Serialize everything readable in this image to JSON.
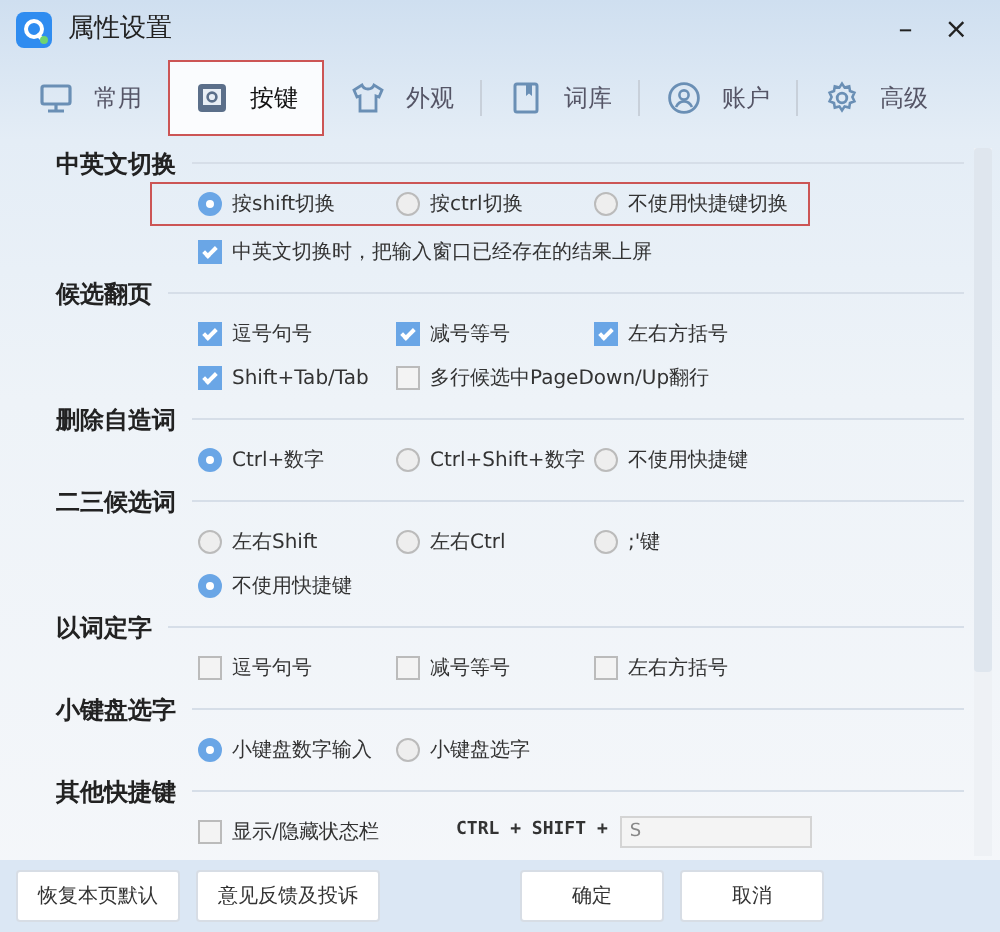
{
  "window": {
    "title": "属性设置",
    "minimize": "–",
    "close": "×"
  },
  "tabs": [
    {
      "label": "常用",
      "selected": false
    },
    {
      "label": "按键",
      "selected": true
    },
    {
      "label": "外观",
      "selected": false
    },
    {
      "label": "词库",
      "selected": false
    },
    {
      "label": "账户",
      "selected": false
    },
    {
      "label": "高级",
      "selected": false
    }
  ],
  "sections": [
    {
      "title": "中英文切换",
      "rows": [
        {
          "highlighted": true,
          "options": [
            {
              "kind": "radio",
              "label": "按shift切换",
              "selected": true
            },
            {
              "kind": "radio",
              "label": "按ctrl切换",
              "selected": false
            },
            {
              "kind": "radio",
              "label": "不使用快捷键切换",
              "selected": false
            }
          ]
        },
        {
          "highlighted": false,
          "options": [
            {
              "kind": "checkbox",
              "label": "中英文切换时，把输入窗口已经存在的结果上屏",
              "checked": true
            }
          ]
        }
      ]
    },
    {
      "title": "候选翻页",
      "rows": [
        {
          "highlighted": false,
          "options": [
            {
              "kind": "checkbox",
              "label": "逗号句号",
              "checked": true
            },
            {
              "kind": "checkbox",
              "label": "减号等号",
              "checked": true
            },
            {
              "kind": "checkbox",
              "label": "左右方括号",
              "checked": true
            }
          ]
        },
        {
          "highlighted": false,
          "options": [
            {
              "kind": "checkbox",
              "label": "Shift+Tab/Tab",
              "checked": true
            },
            {
              "kind": "checkbox",
              "label": "多行候选中PageDown/Up翻行",
              "checked": false
            }
          ]
        }
      ]
    },
    {
      "title": "删除自造词",
      "rows": [
        {
          "highlighted": false,
          "options": [
            {
              "kind": "radio",
              "label": "Ctrl+数字",
              "selected": true
            },
            {
              "kind": "radio",
              "label": "Ctrl+Shift+数字",
              "selected": false
            },
            {
              "kind": "radio",
              "label": "不使用快捷键",
              "selected": false
            }
          ]
        }
      ]
    },
    {
      "title": "二三候选词",
      "rows": [
        {
          "highlighted": false,
          "options": [
            {
              "kind": "radio",
              "label": "左右Shift",
              "selected": false
            },
            {
              "kind": "radio",
              "label": "左右Ctrl",
              "selected": false
            },
            {
              "kind": "radio",
              "label": ";'键",
              "selected": false
            }
          ]
        },
        {
          "highlighted": false,
          "options": [
            {
              "kind": "radio",
              "label": "不使用快捷键",
              "selected": true
            }
          ]
        }
      ]
    },
    {
      "title": "以词定字",
      "rows": [
        {
          "highlighted": false,
          "options": [
            {
              "kind": "checkbox",
              "label": "逗号句号",
              "checked": false
            },
            {
              "kind": "checkbox",
              "label": "减号等号",
              "checked": false
            },
            {
              "kind": "checkbox",
              "label": "左右方括号",
              "checked": false
            }
          ]
        }
      ]
    },
    {
      "title": "小键盘选字",
      "rows": [
        {
          "highlighted": false,
          "options": [
            {
              "kind": "radio",
              "label": "小键盘数字输入",
              "selected": true
            },
            {
              "kind": "radio",
              "label": "小键盘选字",
              "selected": false
            }
          ]
        }
      ]
    },
    {
      "title": "其他快捷键",
      "rows": [
        {
          "highlighted": false,
          "options": [
            {
              "kind": "checkbox",
              "label": "显示/隐藏状态栏",
              "checked": false
            },
            {
              "kind": "shortcut",
              "label": "CTRL + SHIFT +",
              "value": "S"
            }
          ]
        }
      ]
    }
  ],
  "footer": {
    "left_buttons": [
      "恢复本页默认",
      "意见反馈及投诉"
    ],
    "right_buttons": [
      "确定",
      "取消"
    ]
  }
}
